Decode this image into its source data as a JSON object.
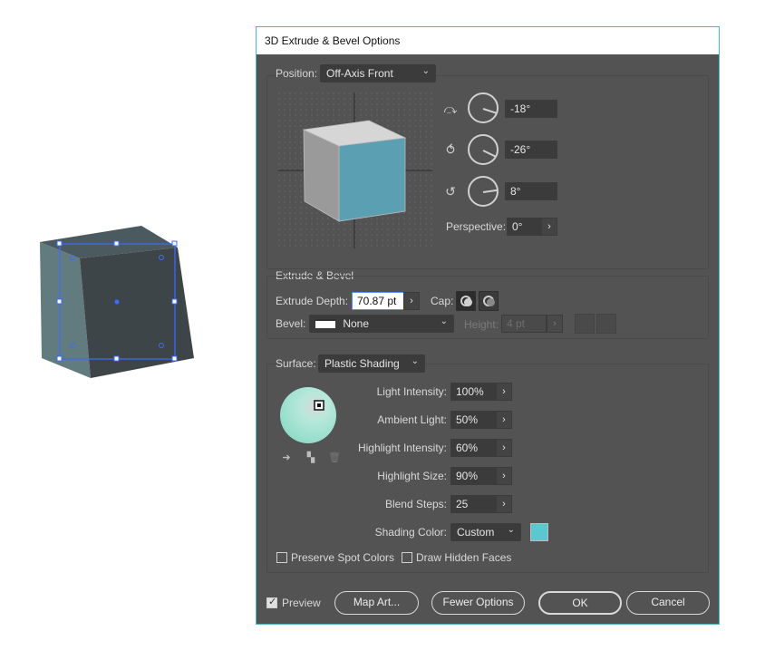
{
  "dialog": {
    "title": "3D Extrude & Bevel Options"
  },
  "position": {
    "label": "Position:",
    "value": "Off-Axis Front",
    "rotation_x": "-18°",
    "rotation_y": "-26°",
    "rotation_z": "8°",
    "perspective_label": "Perspective:",
    "perspective_value": "0°"
  },
  "extrude": {
    "section_label": "Extrude & Bevel",
    "depth_label": "Extrude Depth:",
    "depth_value": "70.87 pt",
    "cap_label": "Cap:",
    "bevel_label": "Bevel:",
    "bevel_value": "None",
    "height_label": "Height:",
    "height_value": "4 pt"
  },
  "surface": {
    "label": "Surface:",
    "value": "Plastic Shading",
    "light_intensity_label": "Light Intensity:",
    "light_intensity_value": "100%",
    "ambient_light_label": "Ambient Light:",
    "ambient_light_value": "50%",
    "highlight_intensity_label": "Highlight Intensity:",
    "highlight_intensity_value": "60%",
    "highlight_size_label": "Highlight Size:",
    "highlight_size_value": "90%",
    "blend_steps_label": "Blend Steps:",
    "blend_steps_value": "25",
    "shading_color_label": "Shading Color:",
    "shading_color_value": "Custom",
    "shading_swatch_color": "#5bc7d1",
    "light_sphere_color": "#9fe0cf"
  },
  "options": {
    "preserve_spot_colors": "Preserve Spot Colors",
    "draw_hidden_faces": "Draw Hidden Faces"
  },
  "footer": {
    "preview_label": "Preview",
    "preview_checked": true,
    "map_art_label": "Map Art...",
    "fewer_options_label": "Fewer Options",
    "ok_label": "OK",
    "cancel_label": "Cancel"
  },
  "colors": {
    "dialog_bg": "#535353",
    "accent": "#4fb8c4",
    "cube_front": "#5b9fb3",
    "cube_side": "#9a9a9a"
  }
}
